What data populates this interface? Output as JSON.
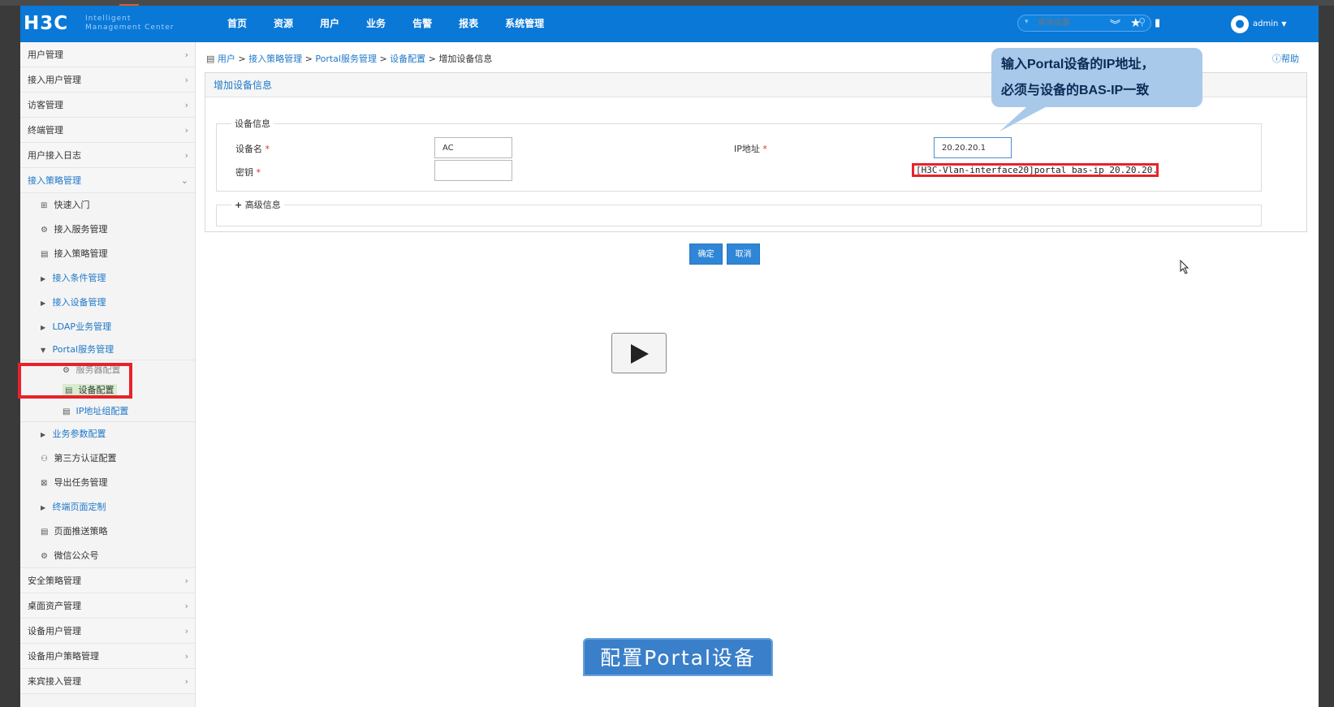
{
  "header": {
    "logo": "H3C",
    "logo_sub_1": "Intelligent",
    "logo_sub_2": "Management Center",
    "nav": [
      "首页",
      "资源",
      "用户",
      "业务",
      "告警",
      "报表",
      "系统管理"
    ],
    "search_placeholder": "查询设备",
    "user": "admin"
  },
  "sidebar": {
    "top_items": [
      "用户管理",
      "接入用户管理",
      "访客管理",
      "终端管理",
      "用户接入日志"
    ],
    "open_item": "接入策略管理",
    "sub_items": {
      "quick": "快速入门",
      "service": "接入服务管理",
      "policy": "接入策略管理",
      "cond": "接入条件管理",
      "device": "接入设备管理",
      "ldap": "LDAP业务管理",
      "portal": "Portal服务管理",
      "portal_server": "服务器配置",
      "portal_device": "设备配置",
      "portal_ipgroup": "IP地址组配置",
      "param": "业务参数配置",
      "third": "第三方认证配置",
      "export": "导出任务管理",
      "page_custom": "终端页面定制",
      "push": "页面推送策略",
      "wechat": "微信公众号"
    },
    "bottom_items": [
      "安全策略管理",
      "桌面资产管理",
      "设备用户管理",
      "设备用户策略管理",
      "来宾接入管理"
    ]
  },
  "breadcrumb": {
    "items": [
      "用户",
      "接入策略管理",
      "Portal服务管理",
      "设备配置"
    ],
    "current": "增加设备信息",
    "sep": ">"
  },
  "help": "帮助",
  "panel": {
    "title": "增加设备信息",
    "device_info_legend": "设备信息",
    "device_name_label": "设备名",
    "device_name_value": "AC",
    "ip_label": "IP地址",
    "ip_value": "20.20.20.1",
    "key_label": "密钥",
    "key_value": "",
    "required_mark": "*",
    "advanced_legend": "高级信息"
  },
  "command_hint": "[H3C-Vlan-interface20]portal bas-ip 20.20.20.1",
  "bubble": {
    "line1": "输入Portal设备的IP地址，",
    "line2": "必须与设备的BAS-IP一致"
  },
  "buttons": {
    "ok": "确定",
    "cancel": "取消"
  },
  "caption": "配置Portal设备"
}
